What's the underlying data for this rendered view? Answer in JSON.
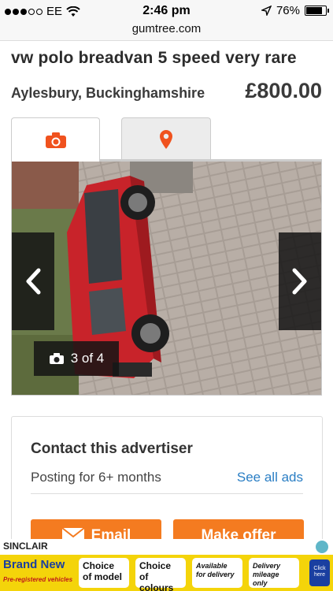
{
  "status_bar": {
    "carrier": "EE",
    "time": "2:46 pm",
    "battery": "76%",
    "battery_level": 0.76
  },
  "browser": {
    "url": "gumtree.com"
  },
  "listing": {
    "title": "vw polo breadvan 5 speed very rare",
    "location": "Aylesbury, Buckinghamshire",
    "price": "£800.00"
  },
  "tabs": [
    {
      "icon": "camera-icon",
      "active": true
    },
    {
      "icon": "location-pin-icon",
      "active": false
    }
  ],
  "gallery": {
    "counter": "3 of 4",
    "prev_icon": "chevron-left-icon",
    "next_icon": "chevron-right-icon"
  },
  "contact": {
    "heading": "Contact this advertiser",
    "posting": "Posting for 6+ months",
    "see_all": "See all ads",
    "email_label": "Email",
    "offer_label": "Make offer"
  },
  "ad": {
    "brand": "SINCLAIR",
    "headline": "Brand New",
    "subline": "Pre-registered vehicles",
    "chip1": "Choice of model",
    "chip2": "Choice of colours",
    "chip3": "Available for delivery",
    "chip4": "Delivery mileage only",
    "click": "Click here"
  },
  "colors": {
    "accent": "#f47b20",
    "link": "#2a7ec4",
    "ad_yellow": "#f4d40a"
  }
}
